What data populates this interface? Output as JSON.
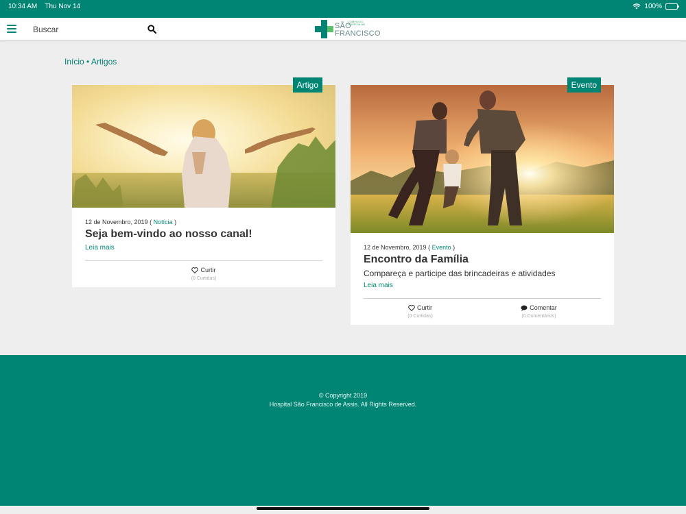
{
  "status_bar": {
    "time": "10:34 AM",
    "date": "Thu Nov 14",
    "battery": "100%",
    "battery_level": 1.0
  },
  "navbar": {
    "search_placeholder": "Buscar",
    "logo_small": "COMPLEXO HOSPITALAR",
    "logo_big": "SÃO FRANCISCO"
  },
  "breadcrumb": {
    "home": "Início",
    "separator": "•",
    "current": "Artigos"
  },
  "cards": [
    {
      "tag": "Artigo",
      "date": "12 de Novembro, 2019",
      "category": "Notícia",
      "title": "Seja bem-vindo ao nosso canal!",
      "read_more": "Leia mais",
      "like_label": "Curtir",
      "like_count": "(0 Curtidas)"
    },
    {
      "tag": "Evento",
      "date": "12 de Novembro, 2019",
      "category": "Evento",
      "title": "Encontro da Família",
      "description": "Compareça e participe das brincadeiras e atividades",
      "read_more": "Leia mais",
      "like_label": "Curtir",
      "like_count": "(0 Curtidas)",
      "comment_label": "Comentar",
      "comment_count": "(0 Comentários)"
    }
  ],
  "footer": {
    "copyright": "© Copyright 2019",
    "rights": "Hospital São Francisco de Assis. All Rights Reserved."
  },
  "colors": {
    "brand": "#008575",
    "background": "#eeeeee"
  }
}
